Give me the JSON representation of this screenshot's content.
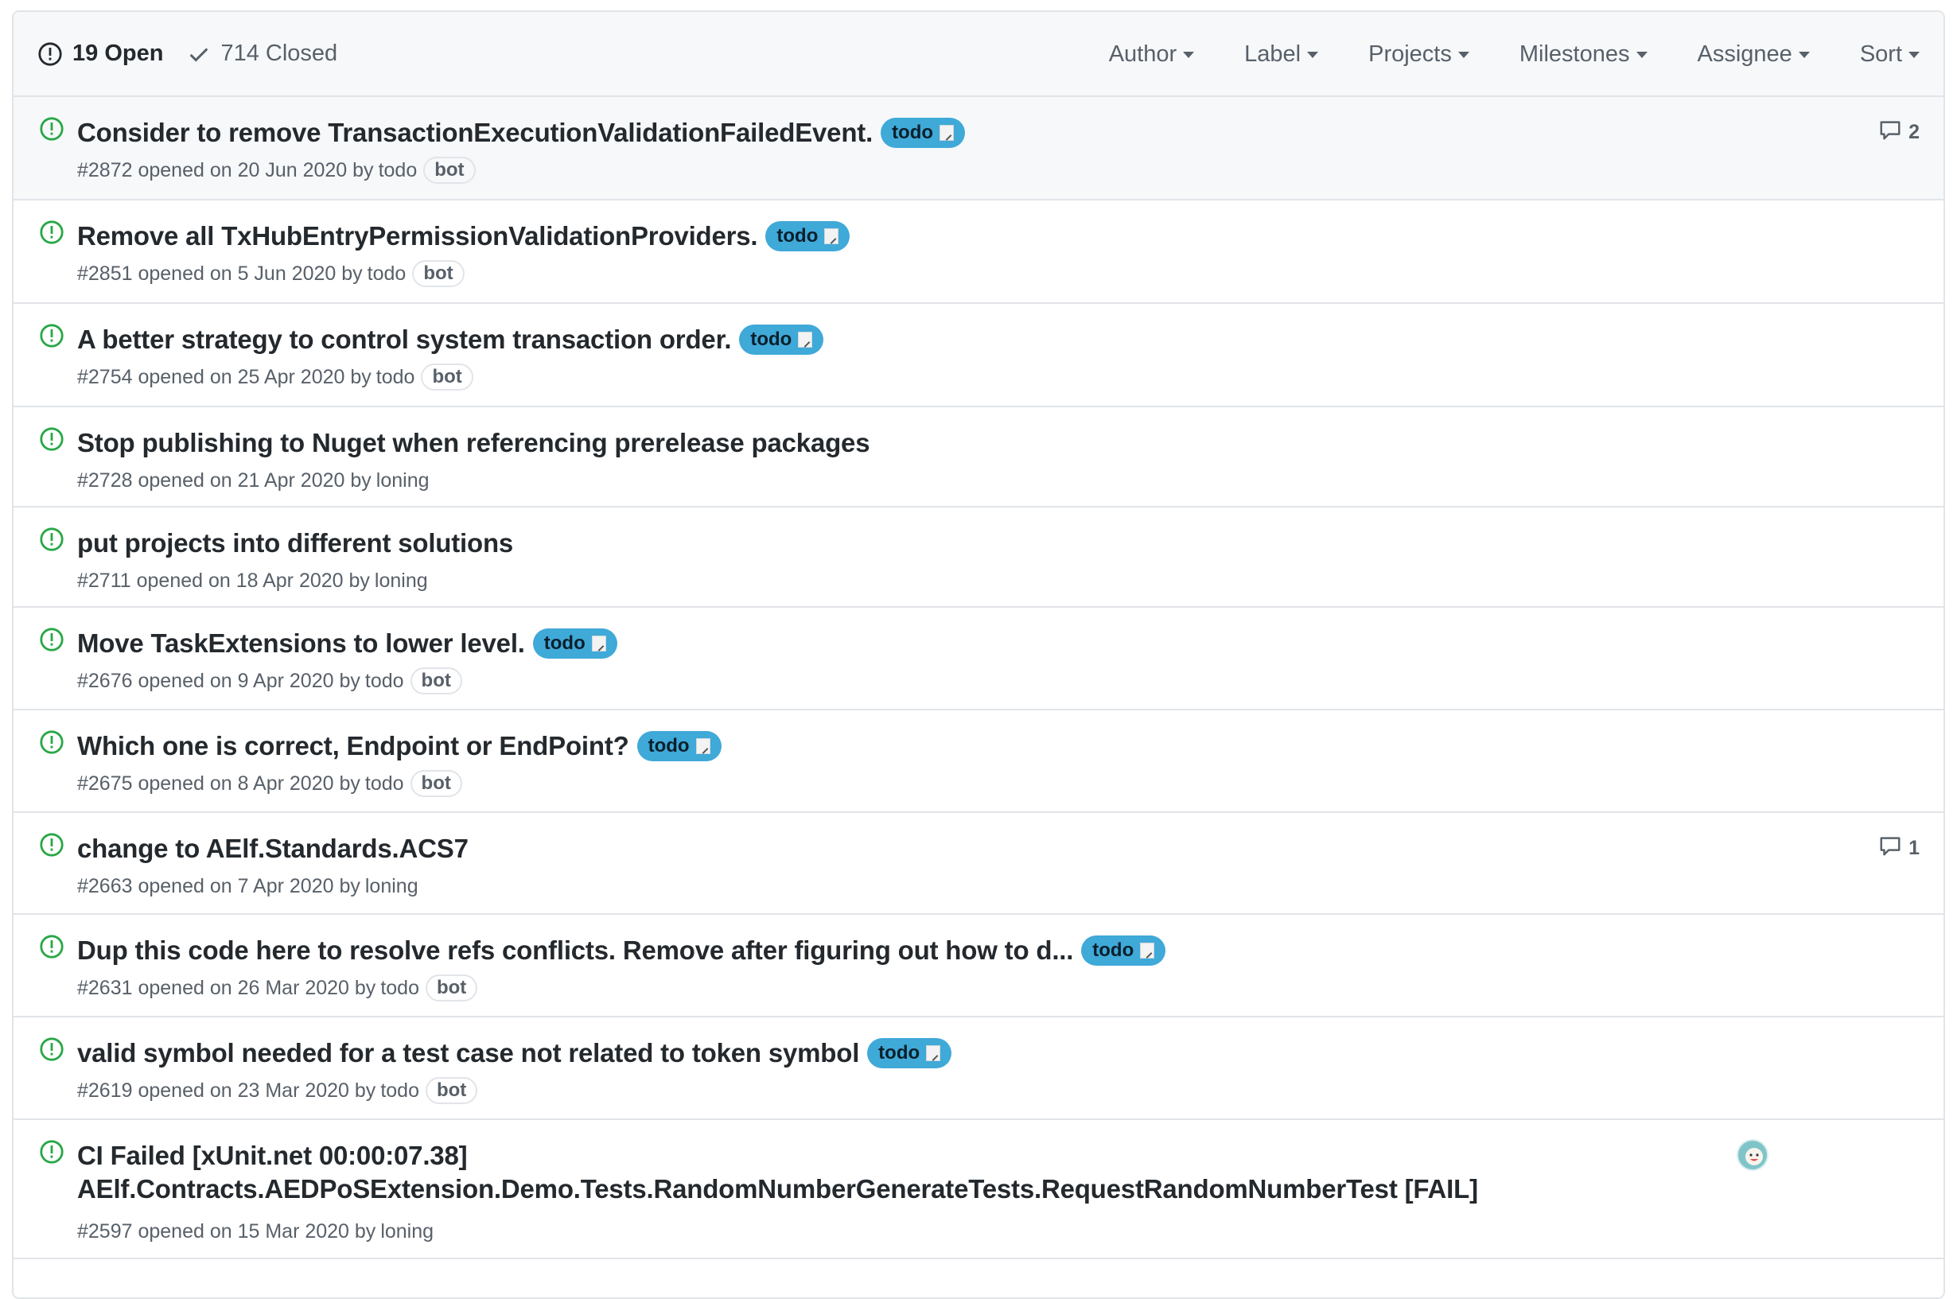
{
  "header": {
    "open_count": "19 Open",
    "closed_count": "714 Closed",
    "filters": [
      "Author",
      "Label",
      "Projects",
      "Milestones",
      "Assignee",
      "Sort"
    ]
  },
  "colors": {
    "open_icon": "#28a745",
    "label_todo": "#3fa9d8",
    "text": "#24292e",
    "muted": "#586069",
    "border": "#e1e4e8"
  },
  "issues": [
    {
      "title": "Consider to remove TransactionExecutionValidationFailedEvent.",
      "label": "todo",
      "meta": "#2872 opened on 20 Jun 2020 by",
      "author": "todo",
      "badge": "bot",
      "comments": "2"
    },
    {
      "title": "Remove all TxHubEntryPermissionValidationProviders.",
      "label": "todo",
      "meta": "#2851 opened on 5 Jun 2020 by",
      "author": "todo",
      "badge": "bot"
    },
    {
      "title": "A better strategy to control system transaction order.",
      "label": "todo",
      "meta": "#2754 opened on 25 Apr 2020 by",
      "author": "todo",
      "badge": "bot"
    },
    {
      "title": "Stop publishing to Nuget when referencing prerelease packages",
      "meta": "#2728 opened on 21 Apr 2020 by",
      "author": "loning"
    },
    {
      "title": "put projects into different solutions",
      "meta": "#2711 opened on 18 Apr 2020 by",
      "author": "loning"
    },
    {
      "title": "Move TaskExtensions to lower level.",
      "label": "todo",
      "meta": "#2676 opened on 9 Apr 2020 by",
      "author": "todo",
      "badge": "bot"
    },
    {
      "title": "Which one is correct, Endpoint or EndPoint?",
      "label": "todo",
      "meta": "#2675 opened on 8 Apr 2020 by",
      "author": "todo",
      "badge": "bot"
    },
    {
      "title": "change to AElf.Standards.ACS7",
      "meta": "#2663 opened on 7 Apr 2020 by",
      "author": "loning",
      "comments": "1"
    },
    {
      "title": "Dup this code here to resolve refs conflicts. Remove after figuring out how to d...",
      "label": "todo",
      "meta": "#2631 opened on 26 Mar 2020 by",
      "author": "todo",
      "badge": "bot"
    },
    {
      "title": "valid symbol needed for a test case not related to token symbol",
      "label": "todo",
      "meta": "#2619 opened on 23 Mar 2020 by",
      "author": "todo",
      "badge": "bot"
    },
    {
      "title": "CI Failed [xUnit.net 00:00:07.38]",
      "title_line2": "AElf.Contracts.AEDPoSExtension.Demo.Tests.RandomNumberGenerateTests.RequestRandomNumberTest [FAIL]",
      "meta": "#2597 opened on 15 Mar 2020 by",
      "author": "loning",
      "has_assignee": true
    }
  ]
}
